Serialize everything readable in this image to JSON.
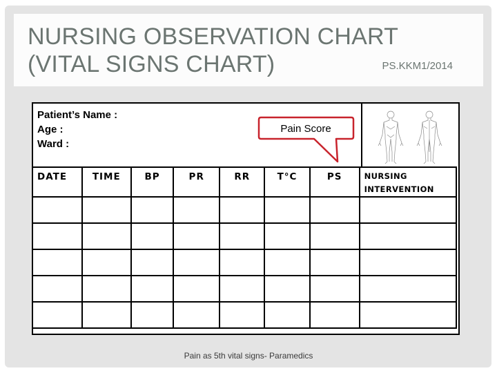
{
  "slide": {
    "title": "NURSING OBSERVATION CHART (VITAL SIGNS CHART)",
    "code": "PS.KKM1/2014",
    "footer": "Pain as 5th vital signs- Paramedics"
  },
  "patient_info": {
    "name_label": "Patient’s Name :",
    "age_label": "Age :",
    "ward_label": "Ward :"
  },
  "callout": {
    "label": "Pain Score",
    "color": "#c8232c"
  },
  "body_diagram": {
    "icon": "human-body-front-back-icon"
  },
  "table": {
    "columns": [
      "DATE",
      "TIME",
      "BP",
      "PR",
      "RR",
      "T°C",
      "PS",
      "NURSING INTERVENTION"
    ],
    "rows": [
      [
        "",
        "",
        "",
        "",
        "",
        "",
        "",
        ""
      ],
      [
        "",
        "",
        "",
        "",
        "",
        "",
        "",
        ""
      ],
      [
        "",
        "",
        "",
        "",
        "",
        "",
        "",
        ""
      ],
      [
        "",
        "",
        "",
        "",
        "",
        "",
        "",
        ""
      ],
      [
        "",
        "",
        "",
        "",
        "",
        "",
        "",
        ""
      ]
    ]
  }
}
